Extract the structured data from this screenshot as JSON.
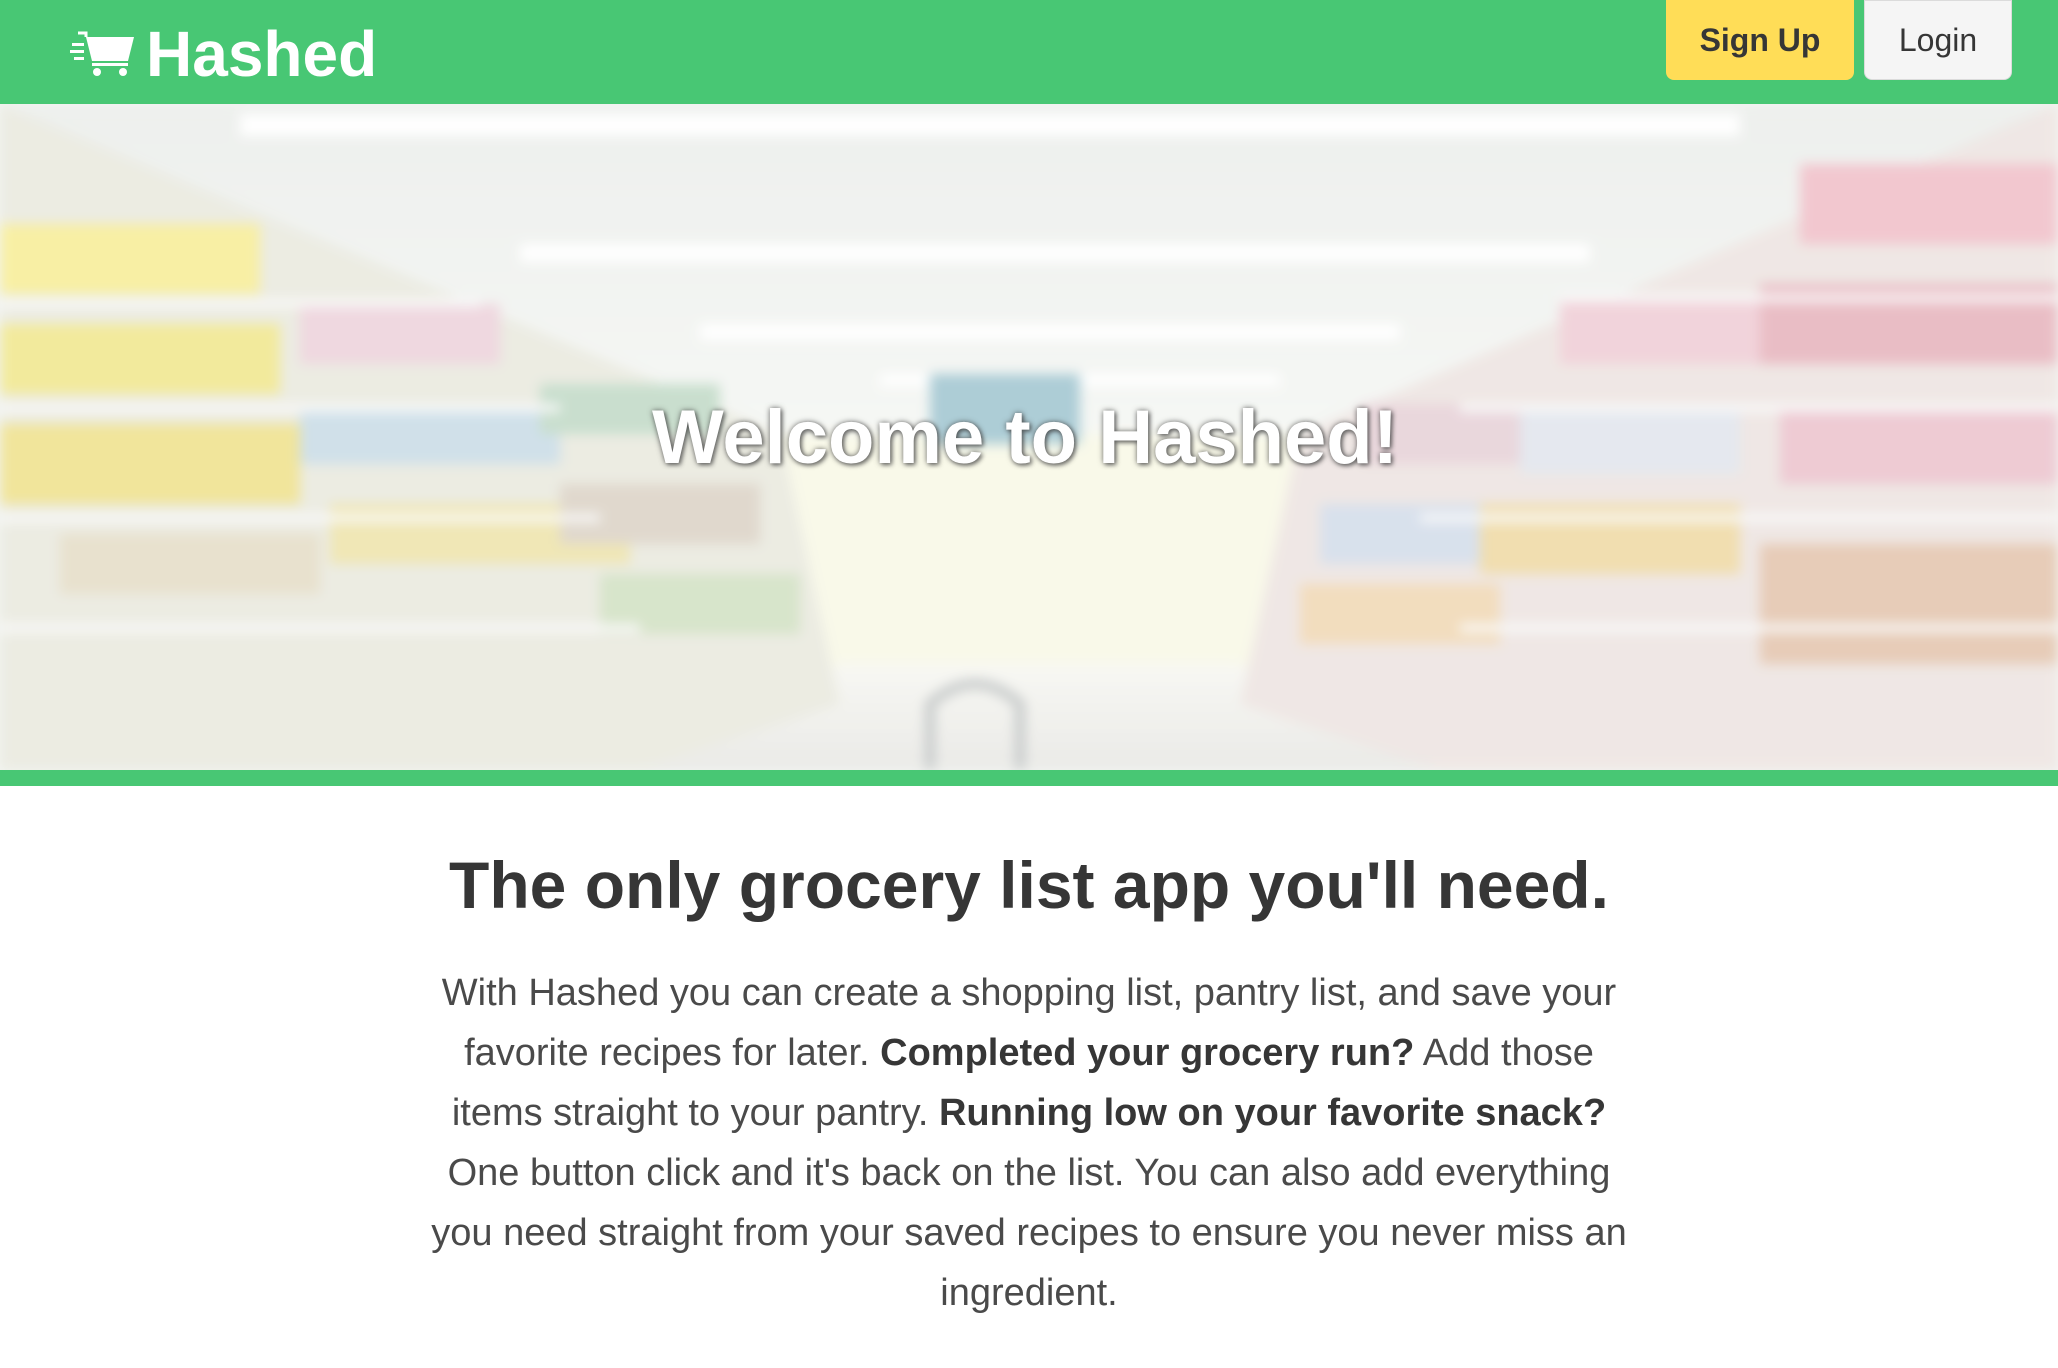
{
  "navbar": {
    "brand_name": "Hashed",
    "brand_icon": "shopping-cart-icon",
    "signup_label": "Sign Up",
    "login_label": "Login"
  },
  "hero": {
    "title": "Welcome to Hashed!"
  },
  "main": {
    "headline": "The only grocery list app you'll need.",
    "description": {
      "p1": "With Hashed you can create a shopping list, pantry list, and save your favorite recipes for later. ",
      "b1": "Completed your grocery run?",
      "p2": " Add those items straight to your pantry. ",
      "b2": "Running low on your favorite snack?",
      "p3": " One button click and it's back on the list. You can also add everything you need straight from your saved recipes to ensure you never miss an ingredient."
    }
  },
  "colors": {
    "brand_green": "#48c774",
    "signup_yellow": "#ffdd57",
    "login_gray": "#f5f5f5",
    "text_dark": "#363636"
  }
}
